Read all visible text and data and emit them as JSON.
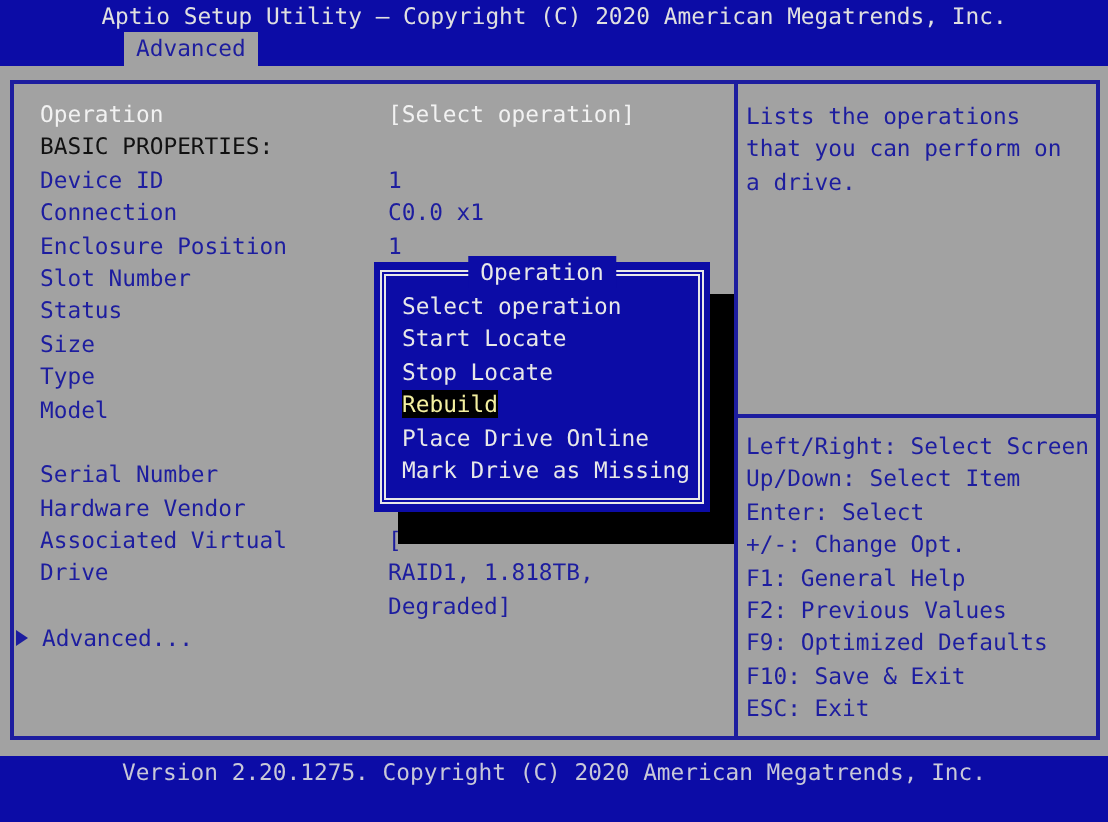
{
  "window": {
    "title": "Aptio Setup Utility – Copyright (C) 2020 American Megatrends, Inc."
  },
  "tabs": [
    {
      "label": "Advanced",
      "selected": true
    }
  ],
  "settings": [
    {
      "kind": "option",
      "label": "Operation",
      "value": "[Select operation]",
      "selected": true
    },
    {
      "kind": "heading",
      "label": "BASIC PROPERTIES:"
    },
    {
      "kind": "info",
      "label": "Device ID",
      "value": "1"
    },
    {
      "kind": "info",
      "label": "Connection",
      "value": "C0.0 x1"
    },
    {
      "kind": "info",
      "label": "Enclosure Position",
      "value": "1"
    },
    {
      "kind": "info",
      "label": "Slot Number"
    },
    {
      "kind": "info",
      "label": "Status"
    },
    {
      "kind": "info",
      "label": "Size"
    },
    {
      "kind": "info",
      "label": "Type"
    },
    {
      "kind": "info",
      "label": "Model"
    },
    {
      "kind": "blank"
    },
    {
      "kind": "info",
      "label": "Serial Number"
    },
    {
      "kind": "info",
      "label": "Hardware Vendor"
    },
    {
      "kind": "info",
      "label": "Associated Virtual",
      "value": "["
    },
    {
      "kind": "info",
      "label": "Drive",
      "value": "RAID1, 1.818TB,"
    },
    {
      "kind": "info",
      "value": "Degraded]"
    },
    {
      "kind": "submenu",
      "label": "Advanced...",
      "selected": false
    }
  ],
  "popup": {
    "title": "Operation",
    "options": [
      {
        "label": "Select operation",
        "selected": false
      },
      {
        "label": "Start Locate",
        "selected": false
      },
      {
        "label": "Stop Locate",
        "selected": false
      },
      {
        "label": "Rebuild",
        "selected": true
      },
      {
        "label": "Place Drive Online",
        "selected": false
      },
      {
        "label": "Mark Drive as Missing",
        "selected": false
      }
    ]
  },
  "help_text": "Lists the operations that you can perform on a drive.",
  "key_help": [
    "Left/Right: Select Screen",
    "Up/Down: Select Item",
    "Enter: Select",
    "+/-: Change Opt.",
    "F1: General Help",
    "F2: Previous Values",
    "F9: Optimized Defaults",
    "F10: Save & Exit",
    "ESC: Exit"
  ],
  "status_bar": "Version 2.20.1275. Copyright (C) 2020 American Megatrends, Inc."
}
